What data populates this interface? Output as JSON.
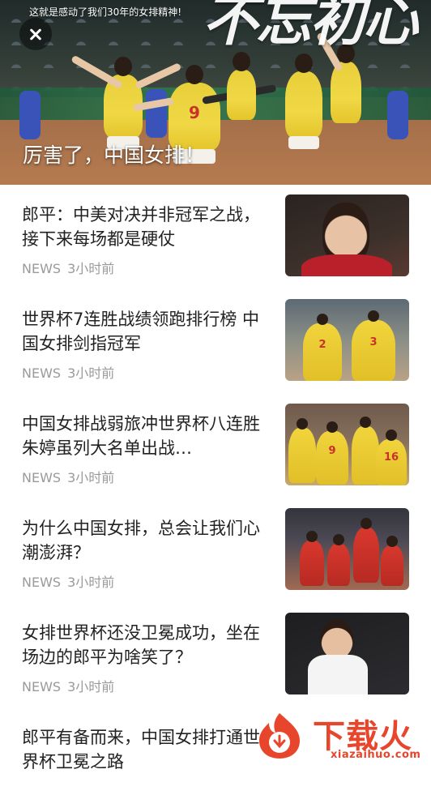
{
  "hero": {
    "subtitle": "这就是感动了我们30年的女排精神!",
    "overlay_text": "不忘初心",
    "caption": "厉害了，中国女排！",
    "jersey_numbers": [
      "9"
    ]
  },
  "close_button": {
    "icon": "close-icon"
  },
  "feed": {
    "items": [
      {
        "title": "郎平：中美对决并非冠军之战，接下来每场都是硬仗",
        "source": "NEWS",
        "time": "3小时前"
      },
      {
        "title": "世界杯7连胜战绩领跑排行榜 中国女排剑指冠军",
        "source": "NEWS",
        "time": "3小时前",
        "jersey_numbers": [
          "2",
          "3"
        ]
      },
      {
        "title": "中国女排战弱旅冲世界杯八连胜 朱婷虽列大名单出战…",
        "source": "NEWS",
        "time": "3小时前",
        "jersey_numbers": [
          "9",
          "16"
        ]
      },
      {
        "title": "为什么中国女排，总会让我们心潮澎湃？",
        "source": "NEWS",
        "time": "3小时前"
      },
      {
        "title": "女排世界杯还没卫冕成功，坐在场边的郎平为啥笑了？",
        "source": "NEWS",
        "time": "3小时前"
      },
      {
        "title": "郎平有备而来，中国女排打通世界杯卫冕之路",
        "source": "",
        "time": ""
      }
    ]
  },
  "watermark": {
    "text": "下载火",
    "domain": "xiazaihuo.com"
  },
  "colors": {
    "accent": "#e8462c",
    "title": "#222222",
    "meta": "#9a9a9a",
    "jersey_yellow": "#f0d845",
    "jersey_red": "#d8382e"
  }
}
